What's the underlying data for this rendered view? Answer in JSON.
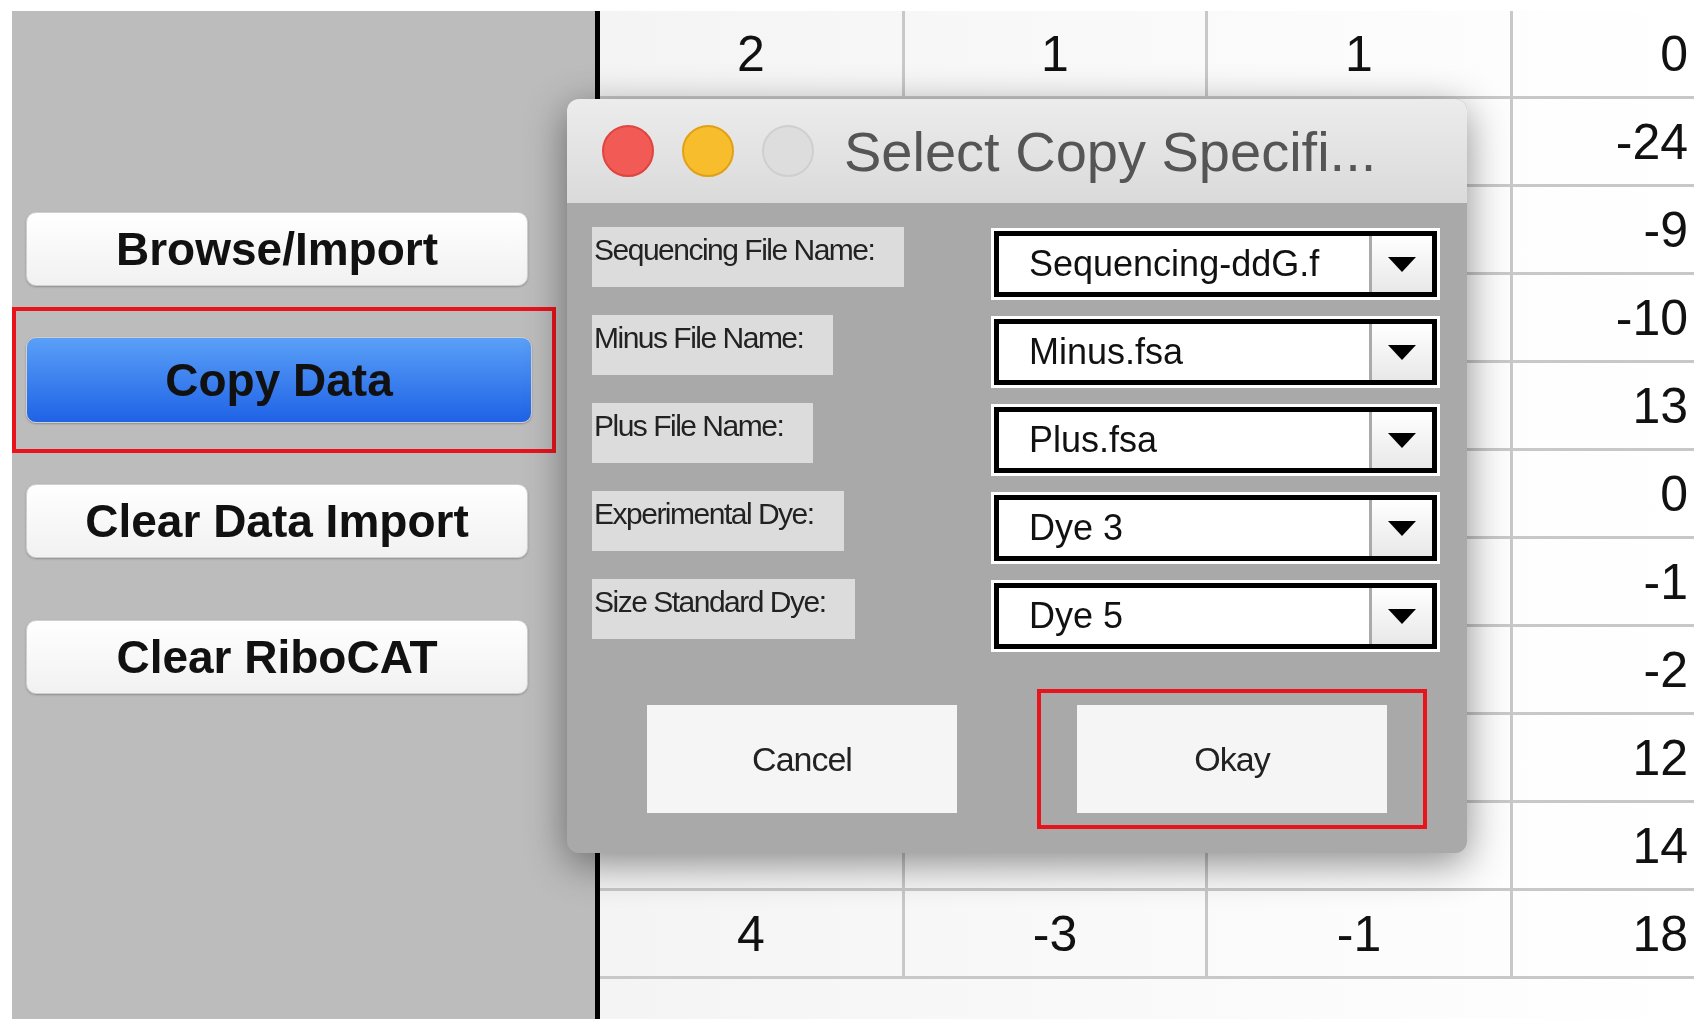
{
  "sidebar": {
    "buttons": [
      {
        "label": "Browse/Import",
        "selected": false,
        "highlighted": false
      },
      {
        "label": "Copy Data",
        "selected": true,
        "highlighted": true
      },
      {
        "label": "Clear Data Import",
        "selected": false,
        "highlighted": false
      },
      {
        "label": "Clear RiboCAT",
        "selected": false,
        "highlighted": false
      }
    ]
  },
  "table": {
    "rows": [
      {
        "column_1": "2",
        "column_2": "1",
        "column_3": "1",
        "column_4": "0"
      },
      {
        "column_4": "-24"
      },
      {
        "column_4": "-9"
      },
      {
        "column_4": "-10"
      },
      {
        "column_4": "13"
      },
      {
        "column_4": "0"
      },
      {
        "column_4": "-1"
      },
      {
        "column_4": "-2"
      },
      {
        "column_4": "12"
      },
      {
        "column_4": "14"
      },
      {
        "column_1": "4",
        "column_2": "-3",
        "column_3": "-1",
        "column_4": "18"
      }
    ]
  },
  "dialog": {
    "title": "Select Copy Specifi...",
    "fields": [
      {
        "label": "Sequencing File Name:",
        "value": "Sequencing-ddG.f"
      },
      {
        "label": "Minus File Name:",
        "value": "Minus.fsa"
      },
      {
        "label": "Plus File Name:",
        "value": "Plus.fsa"
      },
      {
        "label": "Experimental Dye:",
        "value": "Dye 3"
      },
      {
        "label": "Size Standard Dye:",
        "value": "Dye 5"
      }
    ],
    "buttons": [
      {
        "label": "Cancel",
        "highlighted": false
      },
      {
        "label": "Okay",
        "highlighted": true
      }
    ]
  }
}
